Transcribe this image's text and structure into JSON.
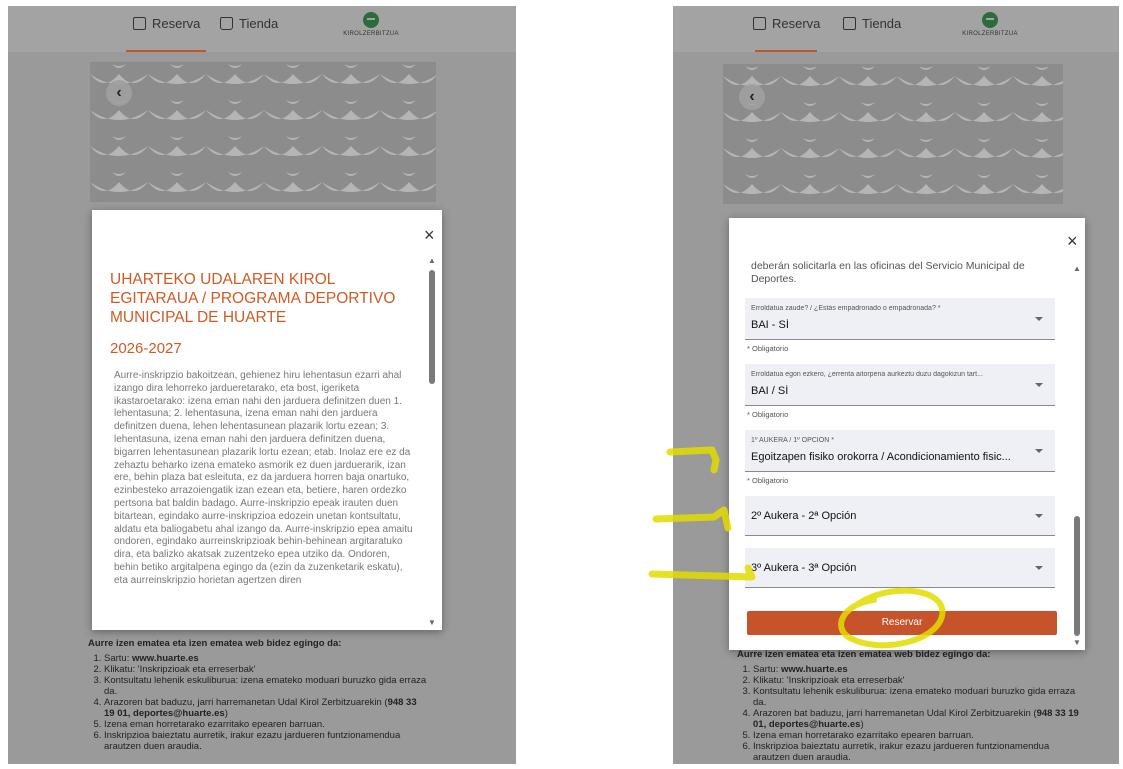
{
  "nav": {
    "reserva": "Reserva",
    "tienda": "Tienda",
    "logo_text": "KIROLZERBITZUA"
  },
  "left_modal": {
    "title": "UHARTEKO UDALAREN KIROL EGITARAUA / PROGRAMA DEPORTIVO MUNICIPAL DE HUARTE",
    "year": "2026-2027",
    "body": "Aurre-inskripzio bakoitzean, gehienez hiru lehentasun ezarri ahal izango dira lehorreko jardueretarako, eta bost, igeriketa ikastaroetarako: izena eman nahi den jarduera definitzen duen 1. lehentasuna; 2. lehentasuna, izena eman nahi den jarduera definitzen duena, lehen lehentasunean plazarik lortu ezean; 3. lehentasuna, izena eman nahi den jarduera definitzen duena, bigarren lehentasunean plazarik lortu ezean; etab. Inolaz ere ez da zehaztu beharko izena emateko asmorik ez duen jarduerarik, izan ere, behin plaza bat esleituta, ez da jarduera horren baja onartuko, ezinbesteko arrazoiengatik izan ezean eta, betiere, haren ordezko pertsona bat baldin badago. Aurre-inskripzio epeak irauten duen bitartean, egindako aurre-inskripzioa edozein unetan kontsultatu, aldatu eta baliogabetu ahal izango da. Aurre-inskripzio epea amaitu ondoren, egindako aurreinskripzioak behin-behinean argitaratuko dira, eta balizko akatsak zuzentzeko epea utziko da. Ondoren, behin betiko argitalpena egingo da (ezin da zuzenketarik eskatu), eta aurreinskripzio horietan agertzen diren",
    "close": "×"
  },
  "below_text": {
    "heading": "Aurre izen ematea eta izen ematea web bidez egingo da:",
    "items": [
      {
        "text": "Sartu: ",
        "bold": "www.huarte.es",
        "after": ""
      },
      {
        "text": "Klikatu: 'Inskripzioak eta erreserbak'",
        "bold": "",
        "after": ""
      },
      {
        "text": "Kontsultatu lehenik eskuliburua: izena emateko moduari buruzko gida erraza da.",
        "bold": "",
        "after": ""
      },
      {
        "text": "Arazoren bat baduzu, jarri harremanetan Udal Kirol Zerbitzuarekin (",
        "bold": "948 33 19 01, deportes@huarte.es",
        "after": ")"
      },
      {
        "text": "Izena eman horretarako ezarritako epearen barruan.",
        "bold": "",
        "after": ""
      },
      {
        "text": "Inskripzioa baieztatu aurretik, irakur ezazu jardueren funtzionamendua arautzen duen araudia.",
        "bold": "",
        "after": ""
      }
    ]
  },
  "right_modal": {
    "intro": "deberán solicitarla en las oficinas del Servicio Municipal de Deportes.",
    "close": "×",
    "fields": [
      {
        "label": "Erroldatua zaude? / ¿Estás empadronado o empadronada? *",
        "value": "BAI - SÍ",
        "required": "* Obligatorio"
      },
      {
        "label": "Erroldatua egon ezkero, ¿errenta aitorpena aurkeztu duzu dagokizun tart...",
        "value": "BAI / SÍ",
        "required": "* Obligatorio"
      },
      {
        "label": "1º AUKERA / 1º OPCION *",
        "value": "Egoitzapen fisiko orokorra / Acondicionamiento fisic...",
        "required": "* Obligatorio"
      },
      {
        "label": "",
        "value": "2º Aukera - 2ª Opción",
        "required": ""
      },
      {
        "label": "",
        "value": "3º Aukera - 3ª Opción",
        "required": ""
      }
    ],
    "submit": "Reservar"
  },
  "colors": {
    "accent": "#d15a23",
    "button": "#c7532a",
    "annotation": "#e8e000",
    "overlay": "#9a9a9a"
  }
}
